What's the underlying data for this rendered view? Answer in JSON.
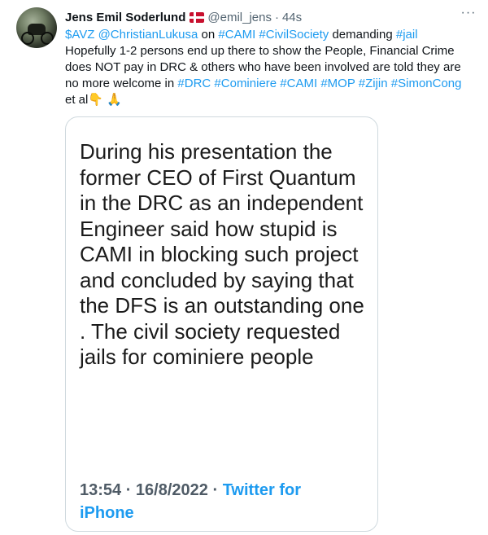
{
  "author": {
    "name": "Jens Emil Soderlund",
    "flag_icon": "denmark-flag-icon",
    "handle": "@emil_jens",
    "separator": "·",
    "time": "44s"
  },
  "more_label": "···",
  "tweet": {
    "segments": [
      {
        "text": "$AVZ",
        "link": true
      },
      {
        "text": " ",
        "link": false
      },
      {
        "text": "@ChristianLukusa",
        "link": true
      },
      {
        "text": " on ",
        "link": false
      },
      {
        "text": "#CAMI",
        "link": true
      },
      {
        "text": " ",
        "link": false
      },
      {
        "text": "#CivilSociety",
        "link": true
      },
      {
        "text": " demanding ",
        "link": false
      },
      {
        "text": "#jail",
        "link": true
      },
      {
        "text": " Hopefully 1-2 persons end up there to show the People, Financial Crime does NOT pay in DRC & others who have been involved are told they are no more welcome in ",
        "link": false
      },
      {
        "text": "#DRC",
        "link": true
      },
      {
        "text": "  ",
        "link": false
      },
      {
        "text": "#Cominiere",
        "link": true
      },
      {
        "text": " ",
        "link": false
      },
      {
        "text": "#CAMI",
        "link": true
      },
      {
        "text": " ",
        "link": false
      },
      {
        "text": "#MOP",
        "link": true
      },
      {
        "text": "  ",
        "link": false
      },
      {
        "text": "#Zijin",
        "link": true
      },
      {
        "text": " ",
        "link": false
      },
      {
        "text": "#SimonCong",
        "link": true
      },
      {
        "text": " et al",
        "link": false
      },
      {
        "text": "👇",
        "link": false
      },
      {
        "text": " 🙏",
        "link": false
      }
    ]
  },
  "media": {
    "quote_text": "During his presentation the former CEO of First Quantum in the DRC as an independent Engineer said how stupid is CAMI in blocking such project and concluded by saying that the DFS is an outstanding one . The civil society requested jails for cominiere people",
    "meta_time": "13:54 · 16/8/2022 · ",
    "meta_source": "Twitter for iPhone"
  },
  "colors": {
    "link": "#1d9bf0",
    "muted": "#536471",
    "text": "#0f1419",
    "border": "#cfd9de"
  }
}
